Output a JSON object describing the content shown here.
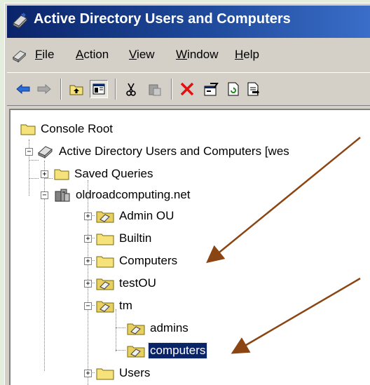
{
  "window": {
    "title": "Active Directory Users and Computers"
  },
  "menu": {
    "items": [
      {
        "label": "File",
        "mnemonic": "F",
        "rest": "ile"
      },
      {
        "label": "Action",
        "mnemonic": "A",
        "rest": "ction"
      },
      {
        "label": "View",
        "mnemonic": "V",
        "rest": "iew"
      },
      {
        "label": "Window",
        "mnemonic": "W",
        "rest": "indow"
      },
      {
        "label": "Help",
        "mnemonic": "H",
        "rest": "elp"
      }
    ]
  },
  "toolbar": {
    "buttons": [
      "back-arrow-icon",
      "forward-arrow-icon",
      "up-folder-icon",
      "show-hide-tree-icon",
      "cut-icon",
      "paste-icon",
      "delete-icon",
      "properties-icon",
      "refresh-icon",
      "export-list-icon"
    ]
  },
  "tree": {
    "console_root": "Console Root",
    "aduc": "Active Directory Users and Computers [wes",
    "saved_queries": "Saved Queries",
    "domain": "oldroadcomputing.net",
    "admin_ou": "Admin OU",
    "builtin": "Builtin",
    "computers": "Computers",
    "test_ou": "testOU",
    "tm": "tm",
    "admins": "admins",
    "tm_computers": "computers",
    "users": "Users"
  },
  "colors": {
    "annotation_arrow": "#8b4513",
    "titlebar": "#0a246a",
    "selection": "#0a246a"
  }
}
